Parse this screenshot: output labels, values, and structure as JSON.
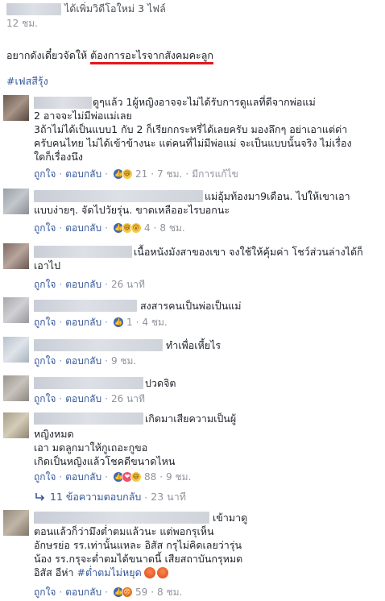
{
  "post": {
    "header_text": "ได้เพิ่มวิดีโอใหม่ 3 ไฟล์",
    "time": "12 ชม.",
    "body_prefix": "อยากดังเดี๋ยวจัดให้",
    "body_underlined": "ต้องการอะไรจากสังคมคะลูก",
    "underline_color": "#e8161b",
    "hashtag": "#เฟสสีรุ้ง"
  },
  "labels": {
    "like": "ถูกใจ",
    "reply": "ตอบกลับ",
    "edited": "มีการแก้ไข"
  },
  "comments": [
    {
      "lines": [
        "ดูๆแล้ว 1ผู้หญิงอาจจะไม่ได้รับการดูแลที่ดีจากพ่อแม่",
        "2 อาจจะไม่มีพ่อแม่เลย",
        "3ถ้าไม่ได้เป็นแบบ1 กับ 2 ก็เรียกกระหรี่ได้เลยครับ มองลึกๆ อย่าเอาแต่ด่า",
        "ครับคนไทย ไม่ได้เข้าข้างนะ แต่คนที่ไม่มีพ่อแม่ จะเป็นแบบนั้นจริง ไม่เรื่อง",
        "ใดก็เรื่องนึง"
      ],
      "reactions": [
        "like-icon",
        "haha-icon"
      ],
      "count": "21",
      "time": "7 ชม."
    },
    {
      "lines": [
        "แม่อุ้มท้องมา9เดือน. ไปให้เขาเอา",
        "แบบง่ายๆ. จัดไปวัยรุ่น. ขาดเหลืออะไรบอกนะ"
      ],
      "reactions": [
        "like-icon",
        "haha-icon",
        "wow-icon"
      ],
      "count": "4",
      "time": "8 ชม."
    },
    {
      "lines": [
        "เนื้อหนังมังสาของเขา จงใช้ให้คุ้มค่า โชว์ส่วนล่างได้ก็",
        "เอาไป"
      ],
      "reactions": [],
      "count": "",
      "time": "26 นาที"
    },
    {
      "lines": [
        "สงสารคนเป็นพ่อเป็นแม่"
      ],
      "reactions": [
        "like-icon"
      ],
      "count": "1",
      "time": "4 ชม."
    },
    {
      "lines": [
        "ทำเพื่อเหี้ยไร"
      ],
      "reactions": [],
      "count": "",
      "time": "9 ชม."
    },
    {
      "lines": [
        "ปวดจิต"
      ],
      "reactions": [],
      "count": "",
      "time": "26 นาที"
    },
    {
      "lines": [
        "เกิดมาเสียความเป็นผู้",
        "หญิงหมด",
        "เอา มดลูกมาให้กูเถอะกูขอ",
        "เกิดเป็นหญิงแล้วโชคดีขนาดไหน"
      ],
      "reactions": [
        "like-icon",
        "love-icon",
        "haha-icon"
      ],
      "count": "88",
      "time": "9 ชม."
    },
    {
      "lines": [
        "เข้ามาดู",
        "ตอนแล้วก็ว่ามึงต่ำตมแล้วนะ แต่พอกรุเห็น",
        "อักษรย่อ รร.เท่านั้นแหละ อิสัส กรุไม่คิดเลยว่ารุ่น",
        "น้อง รร.กรุจะต่ำตมได้ขนาดนี้ เสียสถาบันกรุหมด",
        "อิสัส อีห่า"
      ],
      "hashtag": "#ต่ำตมไม่หยุด",
      "reactions": [
        "like-icon",
        "angry-icon"
      ],
      "count": "59",
      "time": "8 ชม."
    }
  ],
  "replies_link": {
    "label": "11 ข้อความตอบกลับ",
    "time": "23 นาที"
  },
  "colors": {
    "link": "#365899",
    "meta_gray": "#90949c",
    "hashtag": "#365899"
  }
}
